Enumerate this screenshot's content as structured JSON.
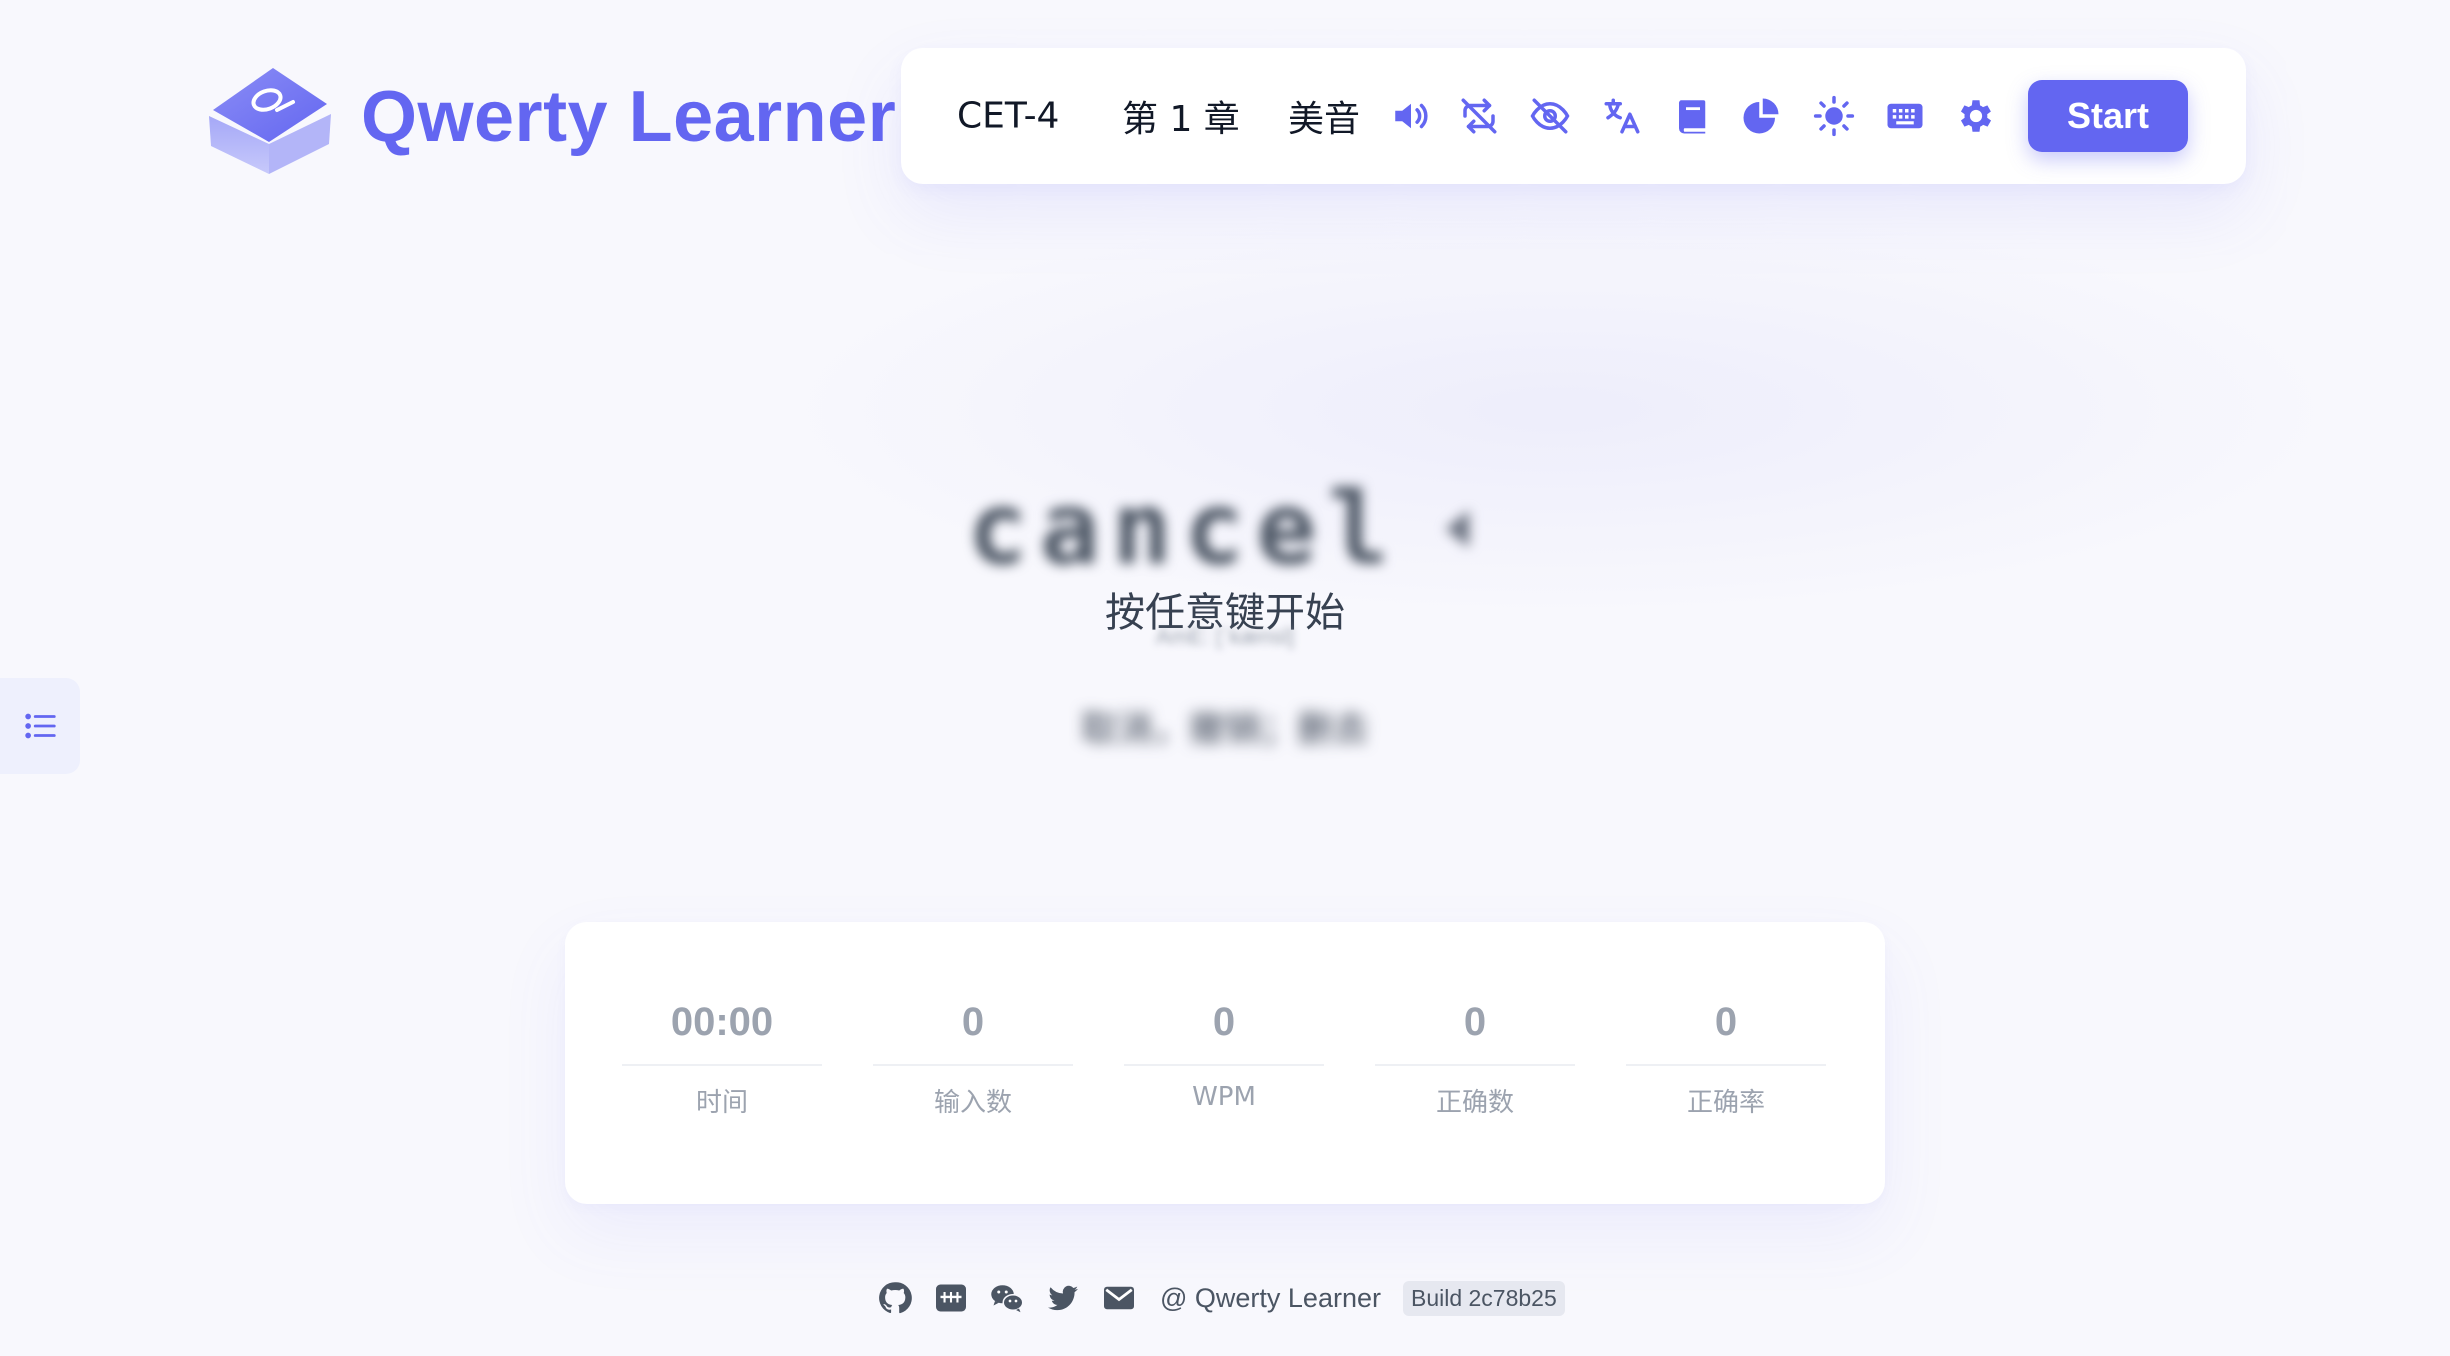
{
  "brand": {
    "title": "Qwerty Learner",
    "logo_icon": "keycap-logo-icon"
  },
  "toolbar": {
    "dict": "CET-4",
    "chapter": "第 1 章",
    "pronunciation": "美音",
    "icons": [
      "speaker-icon",
      "loop-off-icon",
      "eye-slash-icon",
      "translate-icon",
      "book-icon",
      "pie-chart-icon",
      "sun-icon",
      "keyboard-icon",
      "gear-icon"
    ],
    "start_label": "Start",
    "accent_color": "#6366f1"
  },
  "word": {
    "text": "cancel",
    "hint": "按任意键开始",
    "phonetic": "AmE: [ˈkænsl]",
    "translation": "取消，撤销；删去"
  },
  "stats": [
    {
      "value": "00:00",
      "label": "时间"
    },
    {
      "value": "0",
      "label": "输入数"
    },
    {
      "value": "0",
      "label": "WPM"
    },
    {
      "value": "0",
      "label": "正确数"
    },
    {
      "value": "0",
      "label": "正确率"
    }
  ],
  "footer": {
    "icons": [
      "github-icon",
      "xiaohongshu-icon",
      "wechat-icon",
      "twitter-icon",
      "mail-icon"
    ],
    "credit": "@ Qwerty Learner",
    "build": "Build 2c78b25"
  }
}
